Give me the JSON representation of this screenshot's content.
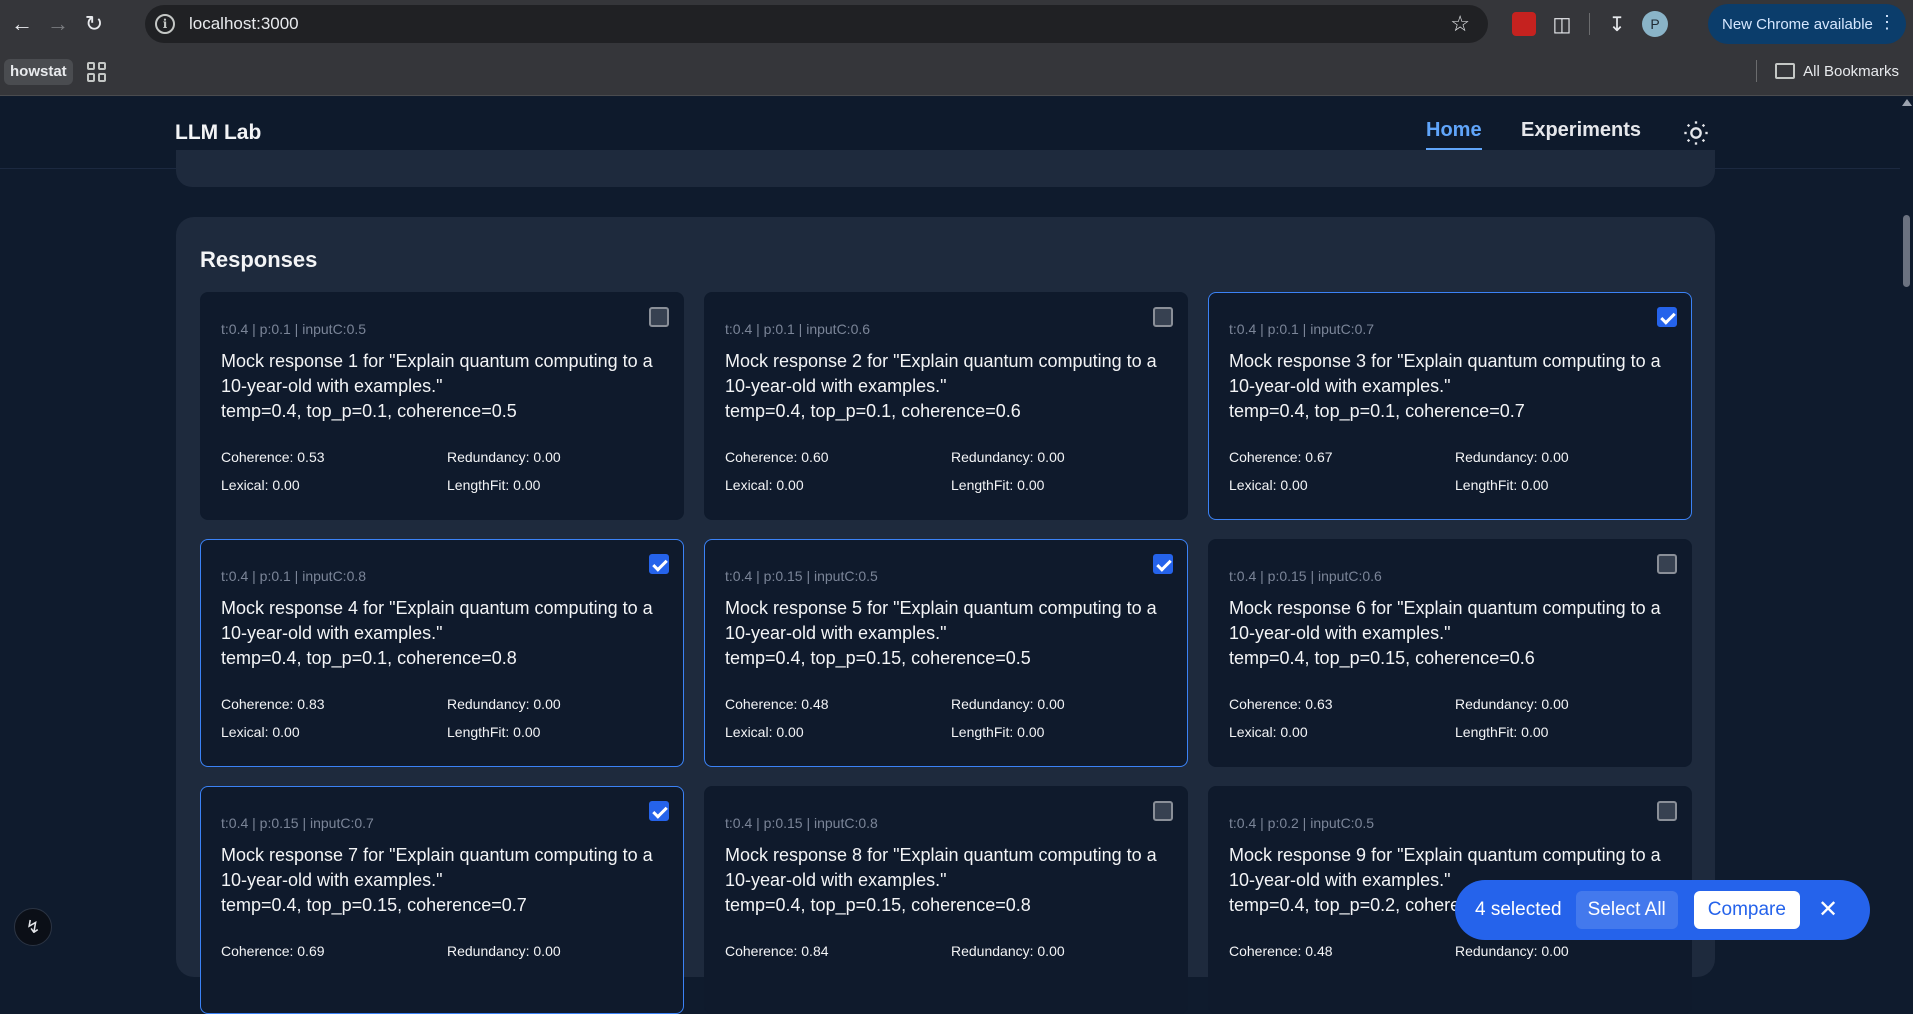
{
  "browser": {
    "url": "localhost:3000",
    "update_label": "New Chrome available",
    "profile_initial": "P",
    "bookmarks": {
      "chip": "howstat",
      "all_bookmarks": "All Bookmarks"
    }
  },
  "app": {
    "brand": "LLM Lab",
    "nav": {
      "home": "Home",
      "experiments": "Experiments"
    }
  },
  "responses": {
    "title": "Responses",
    "metric_labels": {
      "coherence": "Coherence",
      "redundancy": "Redundancy",
      "lexical": "Lexical",
      "lengthfit": "LengthFit"
    },
    "cards": [
      {
        "meta": "t:0.4 | p:0.1 | inputC:0.5",
        "line1": "Mock response 1 for \"Explain quantum computing to a 10-year-old with examples.\"",
        "line2": "temp=0.4, top_p=0.1, coherence=0.5",
        "coherence": "Coherence: 0.53",
        "redundancy": "Redundancy: 0.00",
        "lexical": "Lexical: 0.00",
        "lengthfit": "LengthFit: 0.00",
        "selected": false
      },
      {
        "meta": "t:0.4 | p:0.1 | inputC:0.6",
        "line1": "Mock response 2 for \"Explain quantum computing to a 10-year-old with examples.\"",
        "line2": "temp=0.4, top_p=0.1, coherence=0.6",
        "coherence": "Coherence: 0.60",
        "redundancy": "Redundancy: 0.00",
        "lexical": "Lexical: 0.00",
        "lengthfit": "LengthFit: 0.00",
        "selected": false
      },
      {
        "meta": "t:0.4 | p:0.1 | inputC:0.7",
        "line1": "Mock response 3 for \"Explain quantum computing to a 10-year-old with examples.\"",
        "line2": "temp=0.4, top_p=0.1, coherence=0.7",
        "coherence": "Coherence: 0.67",
        "redundancy": "Redundancy: 0.00",
        "lexical": "Lexical: 0.00",
        "lengthfit": "LengthFit: 0.00",
        "selected": true
      },
      {
        "meta": "t:0.4 | p:0.1 | inputC:0.8",
        "line1": "Mock response 4 for \"Explain quantum computing to a 10-year-old with examples.\"",
        "line2": "temp=0.4, top_p=0.1, coherence=0.8",
        "coherence": "Coherence: 0.83",
        "redundancy": "Redundancy: 0.00",
        "lexical": "Lexical: 0.00",
        "lengthfit": "LengthFit: 0.00",
        "selected": true
      },
      {
        "meta": "t:0.4 | p:0.15 | inputC:0.5",
        "line1": "Mock response 5 for \"Explain quantum computing to a 10-year-old with examples.\"",
        "line2": "temp=0.4, top_p=0.15, coherence=0.5",
        "coherence": "Coherence: 0.48",
        "redundancy": "Redundancy: 0.00",
        "lexical": "Lexical: 0.00",
        "lengthfit": "LengthFit: 0.00",
        "selected": true
      },
      {
        "meta": "t:0.4 | p:0.15 | inputC:0.6",
        "line1": "Mock response 6 for \"Explain quantum computing to a 10-year-old with examples.\"",
        "line2": "temp=0.4, top_p=0.15, coherence=0.6",
        "coherence": "Coherence: 0.63",
        "redundancy": "Redundancy: 0.00",
        "lexical": "Lexical: 0.00",
        "lengthfit": "LengthFit: 0.00",
        "selected": false
      },
      {
        "meta": "t:0.4 | p:0.15 | inputC:0.7",
        "line1": "Mock response 7 for \"Explain quantum computing to a 10-year-old with examples.\"",
        "line2": "temp=0.4, top_p=0.15, coherence=0.7",
        "coherence": "Coherence: 0.69",
        "redundancy": "Redundancy: 0.00",
        "lexical": "",
        "lengthfit": "",
        "selected": true
      },
      {
        "meta": "t:0.4 | p:0.15 | inputC:0.8",
        "line1": "Mock response 8 for \"Explain quantum computing to a 10-year-old with examples.\"",
        "line2": "temp=0.4, top_p=0.15, coherence=0.8",
        "coherence": "Coherence: 0.84",
        "redundancy": "Redundancy: 0.00",
        "lexical": "",
        "lengthfit": "",
        "selected": false
      },
      {
        "meta": "t:0.4 | p:0.2 | inputC:0.5",
        "line1": "Mock response 9 for \"Explain quantum computing to a 10-year-old with examples.\"",
        "line2": "temp=0.4, top_p=0.2, coherence=0.5",
        "coherence": "Coherence: 0.48",
        "redundancy": "Redundancy: 0.00",
        "lexical": "",
        "lengthfit": "",
        "selected": false
      }
    ]
  },
  "selection_bar": {
    "count": "4 selected",
    "select_all": "Select All",
    "compare": "Compare"
  },
  "colors": {
    "accent": "#2563eb",
    "nav_active": "#60a5fa",
    "page_bg": "#0f1b2d",
    "panel_bg": "#1e2a3d",
    "card_bg": "#0f1a2c"
  }
}
